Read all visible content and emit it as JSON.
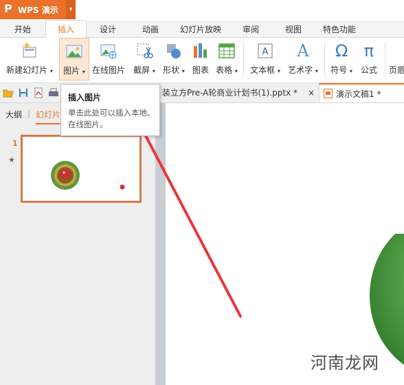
{
  "app": {
    "logo_glyph": "P",
    "title": "WPS 演示",
    "dropdown_glyph": "▾"
  },
  "tabs": [
    "开始",
    "插入",
    "设计",
    "动画",
    "幻灯片放映",
    "审阅",
    "视图",
    "特色功能"
  ],
  "active_tab": "插入",
  "ribbon": {
    "new_slide": "新建幻灯片",
    "picture": "图片",
    "online_picture": "在线图片",
    "screenshot": "截屏",
    "shape": "形状",
    "chart": "图表",
    "table": "表格",
    "textbox": "文本框",
    "wordart": "艺术字",
    "symbol": "符号",
    "formula": "公式",
    "header_footer": "页眉",
    "dropdown_arrow": "▾",
    "omega": "Ω",
    "pi": "π",
    "wordart_glyph": "A"
  },
  "tooltip": {
    "title": "插入图片",
    "body": "单击此处可以插入本地、在线图片。"
  },
  "documents": [
    {
      "name": "装立方Pre-A轮商业计划书(1).pptx *"
    },
    {
      "name": "演示文稿1 *"
    }
  ],
  "doc_close_glyph": "×",
  "left_panel": {
    "outline_tab": "大纲",
    "slides_tab": "幻灯片",
    "slide_number": "1",
    "star_glyph": "★"
  },
  "watermark": "河南龙网",
  "colors": {
    "accent": "#e9712a",
    "arrow": "#e8363a",
    "thumb_border": "#d77a45",
    "green_object": "#3f9a3a"
  }
}
